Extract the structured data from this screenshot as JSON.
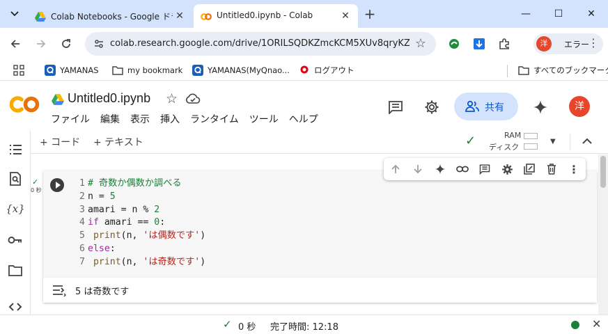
{
  "browser": {
    "tabs": [
      {
        "title": "Colab Notebooks - Google ドラ",
        "active": false,
        "close": "✕"
      },
      {
        "title": "Untitled0.ipynb - Colab",
        "active": true,
        "close": "✕"
      }
    ],
    "new_tab": "+",
    "window_controls": {
      "minimize": "—",
      "maximize": "☐",
      "close": "✕"
    },
    "url": "colab.research.google.com/drive/1ORILSQDKZmcKCM5XUv8qryKZ...",
    "profile": {
      "avatar": "洋",
      "label": "エラー"
    },
    "bookmarks": [
      {
        "label": "YAMANAS",
        "icon": "q-icon"
      },
      {
        "label": "my bookmark",
        "icon": "folder-icon"
      },
      {
        "label": "YAMANAS(MyQnao...",
        "icon": "q-icon"
      },
      {
        "label": "ログアウト",
        "icon": "mufg-icon"
      }
    ],
    "all_bookmarks": "すべてのブックマーク"
  },
  "colab": {
    "notebook_title": "Untitled0.ipynb",
    "menu": [
      "ファイル",
      "編集",
      "表示",
      "挿入",
      "ランタイム",
      "ツール",
      "ヘルプ"
    ],
    "share_label": "共有",
    "avatar": "洋",
    "toolbar": {
      "add_code": "+ コード",
      "add_text": "+ テキスト",
      "ram_label": "RAM",
      "disk_label": "ディスク"
    },
    "cell": {
      "exec_mark": "✓",
      "exec_time": "0 秒",
      "lines": [
        {
          "n": "1",
          "text": "# 奇数か偶数か調べる"
        },
        {
          "n": "2",
          "text": "n = 5"
        },
        {
          "n": "3",
          "text": "amari = n % 2"
        },
        {
          "n": "4",
          "text": "if amari == 0:"
        },
        {
          "n": "5",
          "text": "    print(n, 'は偶数です')"
        },
        {
          "n": "6",
          "text": "else:"
        },
        {
          "n": "7",
          "text": "    print(n, 'は奇数です')"
        }
      ],
      "output": "5 は奇数です"
    },
    "status": {
      "check": "✓",
      "time": "0 秒",
      "completed": "完了時間: 12:18"
    },
    "colors": {
      "accent": "#0b57d0",
      "share_bg": "#d3e3fd",
      "ok_green": "#188038",
      "avatar": "#e8452c",
      "logo_orange": "#f9ab00"
    }
  }
}
